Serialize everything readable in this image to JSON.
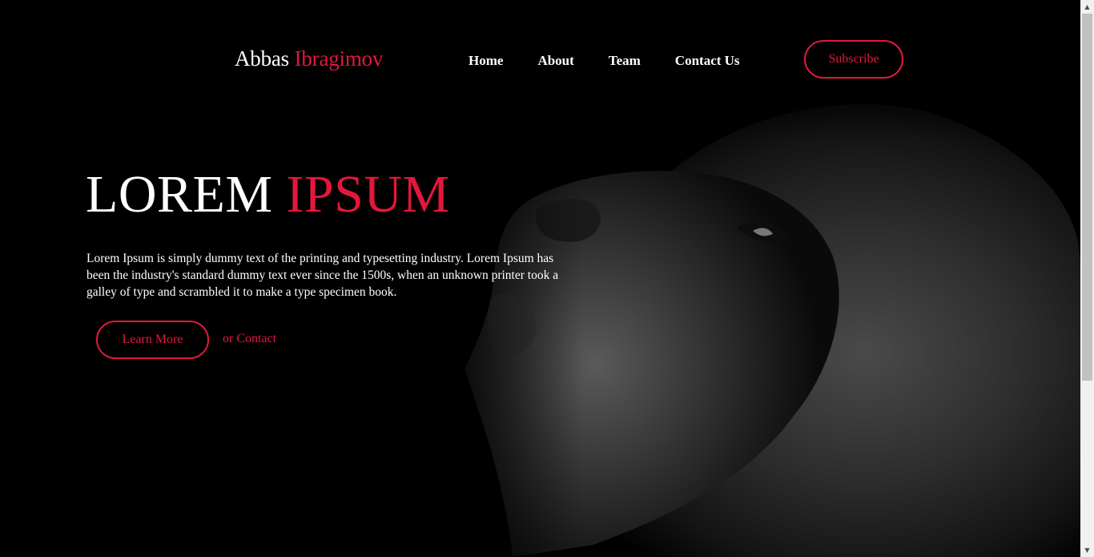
{
  "header": {
    "logo_first": "Abbas",
    "logo_last": "Ibragimov",
    "nav": [
      {
        "label": "Home"
      },
      {
        "label": "About"
      },
      {
        "label": "Team"
      },
      {
        "label": "Contact Us"
      }
    ],
    "subscribe_label": "Subscribe"
  },
  "hero": {
    "title_white": "LOREM",
    "title_red": "IPSUM",
    "paragraph": "Lorem Ipsum is simply dummy text of the printing and typesetting industry. Lorem Ipsum has been the industry's standard dummy text ever since the 1500s, when an unknown printer took a galley of type and scrambled it to make a type specimen book.",
    "learn_more_label": "Learn More",
    "contact_label": "or Contact",
    "image_subject": "lion-photo"
  },
  "colors": {
    "accent": "#e3173b",
    "background": "#000000",
    "text": "#ffffff"
  },
  "scrollbar": {
    "up_icon": "▲",
    "down_icon": "▼"
  }
}
